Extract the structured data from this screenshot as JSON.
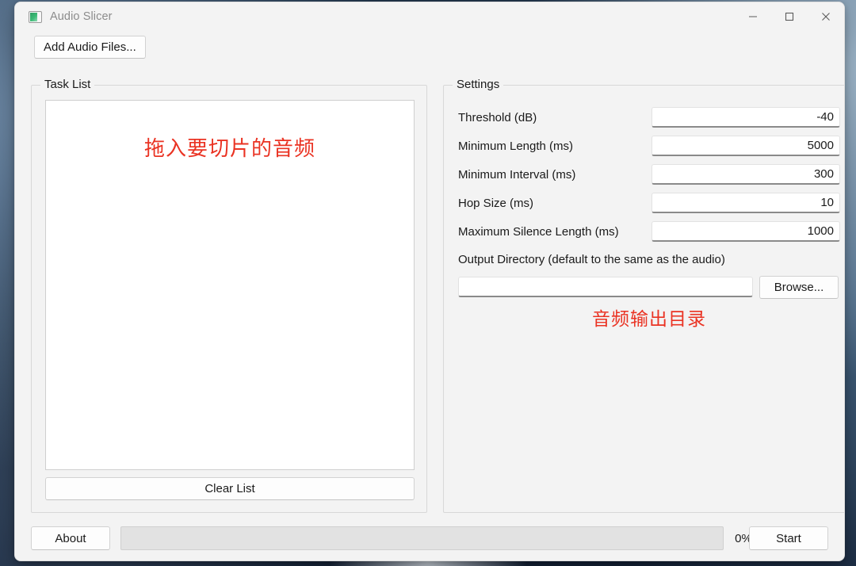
{
  "window": {
    "title": "Audio Slicer",
    "icon": "app-icon",
    "controls": {
      "minimize": "minimize-icon",
      "maximize": "maximize-icon",
      "close": "close-icon"
    }
  },
  "toolbar": {
    "add_audio_files_label": "Add Audio Files..."
  },
  "task_list": {
    "group_title": "Task List",
    "drop_hint": "拖入要切片的音频",
    "clear_list_label": "Clear List"
  },
  "settings": {
    "group_title": "Settings",
    "fields": [
      {
        "label": "Threshold (dB)",
        "value": "-40"
      },
      {
        "label": "Minimum Length (ms)",
        "value": "5000"
      },
      {
        "label": "Minimum Interval (ms)",
        "value": "300"
      },
      {
        "label": "Hop Size (ms)",
        "value": "10"
      },
      {
        "label": "Maximum Silence Length (ms)",
        "value": "1000"
      }
    ],
    "output_directory": {
      "label": "Output Directory (default to the same as the audio)",
      "value": "",
      "placeholder": "",
      "browse_label": "Browse...",
      "hint": "音频输出目录"
    }
  },
  "bottom_bar": {
    "about_label": "About",
    "progress_percent_label": "0%",
    "progress_value": 0,
    "start_label": "Start"
  },
  "colors": {
    "accent": "#0067c0",
    "annotation_red": "#ea3323",
    "window_bg": "#f3f3f3",
    "close_hover": "#e81123"
  }
}
